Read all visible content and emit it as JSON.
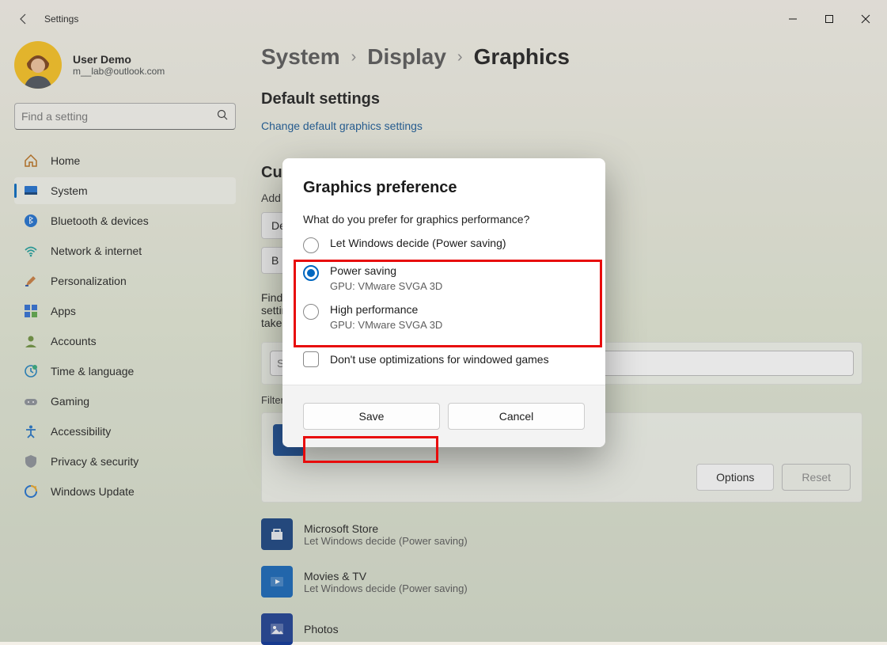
{
  "titlebar": {
    "title": "Settings"
  },
  "user": {
    "name": "User Demo",
    "email": "m__lab@outlook.com"
  },
  "search": {
    "placeholder": "Find a setting"
  },
  "nav": {
    "items": [
      {
        "label": "Home"
      },
      {
        "label": "System"
      },
      {
        "label": "Bluetooth & devices"
      },
      {
        "label": "Network & internet"
      },
      {
        "label": "Personalization"
      },
      {
        "label": "Apps"
      },
      {
        "label": "Accounts"
      },
      {
        "label": "Time & language"
      },
      {
        "label": "Gaming"
      },
      {
        "label": "Accessibility"
      },
      {
        "label": "Privacy & security"
      },
      {
        "label": "Windows Update"
      }
    ]
  },
  "breadcrumb": {
    "a": "System",
    "b": "Display",
    "c": "Graphics"
  },
  "headers": {
    "default_settings": "Default settings",
    "change_link": "Change default graphics settings",
    "custom_title": "Cus",
    "add_label": "Add",
    "select_de": "De",
    "select_b": "B",
    "find_text": "Find",
    "setting_text": "settir",
    "take_text": "take",
    "search2_ph": "Sea",
    "filter": "Filter",
    "options": "Options",
    "reset": "Reset"
  },
  "apps": [
    {
      "name": "Microsoft Store",
      "sub": "Let Windows decide (Power saving)"
    },
    {
      "name": "Movies & TV",
      "sub": "Let Windows decide (Power saving)"
    },
    {
      "name": "Photos",
      "sub": ""
    }
  ],
  "dialog": {
    "title": "Graphics preference",
    "question": "What do you prefer for graphics performance?",
    "opt0": "Let Windows decide (Power saving)",
    "opt1": "Power saving",
    "opt1_sub": "GPU: VMware SVGA 3D",
    "opt2": "High performance",
    "opt2_sub": "GPU: VMware SVGA 3D",
    "dont_optimize": "Don't use optimizations for windowed games",
    "save": "Save",
    "cancel": "Cancel"
  }
}
